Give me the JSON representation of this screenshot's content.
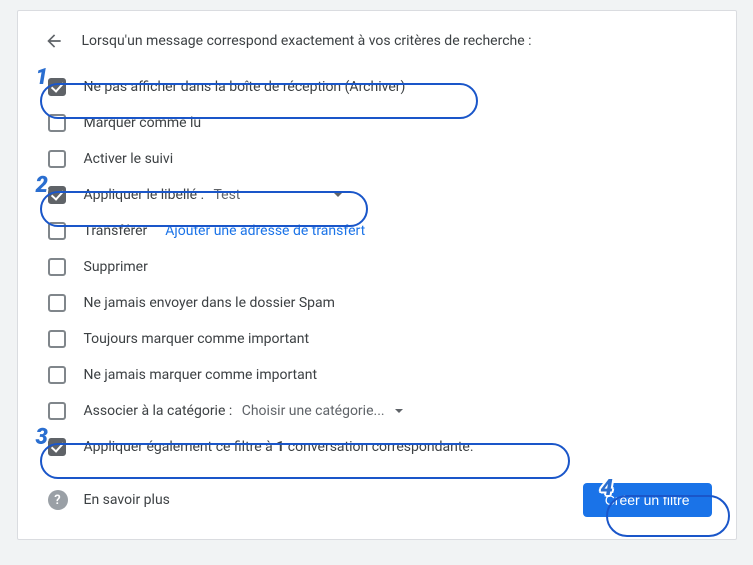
{
  "header": {
    "text": "Lorsqu'un message correspond exactement à vos critères de recherche :"
  },
  "options": {
    "archive": "Ne pas afficher dans la boîte de réception (Archiver)",
    "read": "Marquer comme lu",
    "star": "Activer le suivi",
    "label_prefix": "Appliquer le libellé :",
    "label_value": "Test",
    "forward": "Transférer",
    "forward_link": "Ajouter une adresse de transfert",
    "delete": "Supprimer",
    "nospam": "Ne jamais envoyer dans le dossier Spam",
    "important": "Toujours marquer comme important",
    "noimportant": "Ne jamais marquer comme important",
    "category_prefix": "Associer à la catégorie :",
    "category_value": "Choisir une catégorie...",
    "apply_prefix": "Appliquer également ce filtre à ",
    "apply_count": "1",
    "apply_suffix": " conversation correspondante."
  },
  "footer": {
    "learn_more": "En savoir plus",
    "create": "Créer un filtre"
  },
  "annotations": {
    "b1": "1",
    "b2": "2",
    "b3": "3",
    "b4": "4"
  }
}
